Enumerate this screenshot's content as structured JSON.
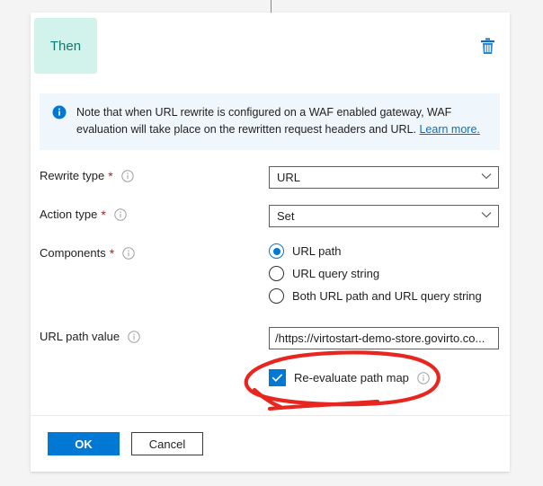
{
  "card": {
    "condition_chip_label": "Then",
    "delete_icon": "trash-icon"
  },
  "banner": {
    "icon": "info-filled-icon",
    "text": "Note that when URL rewrite is configured on a WAF enabled gateway, WAF evaluation will take place on the rewritten request headers and URL. ",
    "link_label": "Learn more."
  },
  "form": {
    "rewrite_type": {
      "label": "Rewrite type",
      "required_marker": "*",
      "info_icon": "info-circle-icon",
      "value": "URL",
      "chevron": "⌄"
    },
    "action_type": {
      "label": "Action type",
      "required_marker": "*",
      "info_icon": "info-circle-icon",
      "value": "Set",
      "chevron": "⌄"
    },
    "components": {
      "label": "Components",
      "required_marker": "*",
      "info_icon": "info-circle-icon",
      "options": [
        {
          "label": "URL path",
          "selected": true
        },
        {
          "label": "URL query string",
          "selected": false
        },
        {
          "label": "Both URL path and URL query string",
          "selected": false
        }
      ]
    },
    "url_path_value": {
      "label": "URL path value",
      "info_icon": "info-circle-icon",
      "value": "/https://virtostart-demo-store.govirto.co..."
    },
    "re_evaluate_path_map": {
      "label": "Re-evaluate path map",
      "info_icon": "info-circle-icon",
      "checked": true,
      "check_glyph": "✓"
    }
  },
  "footer": {
    "ok_label": "OK",
    "cancel_label": "Cancel"
  },
  "colors": {
    "accent": "#0078d4",
    "chip_bg": "#d2f2ec",
    "chip_text": "#0f7a6e",
    "banner_bg": "#eff6fc",
    "required": "#a4262c",
    "annotation": "#e8251f"
  }
}
